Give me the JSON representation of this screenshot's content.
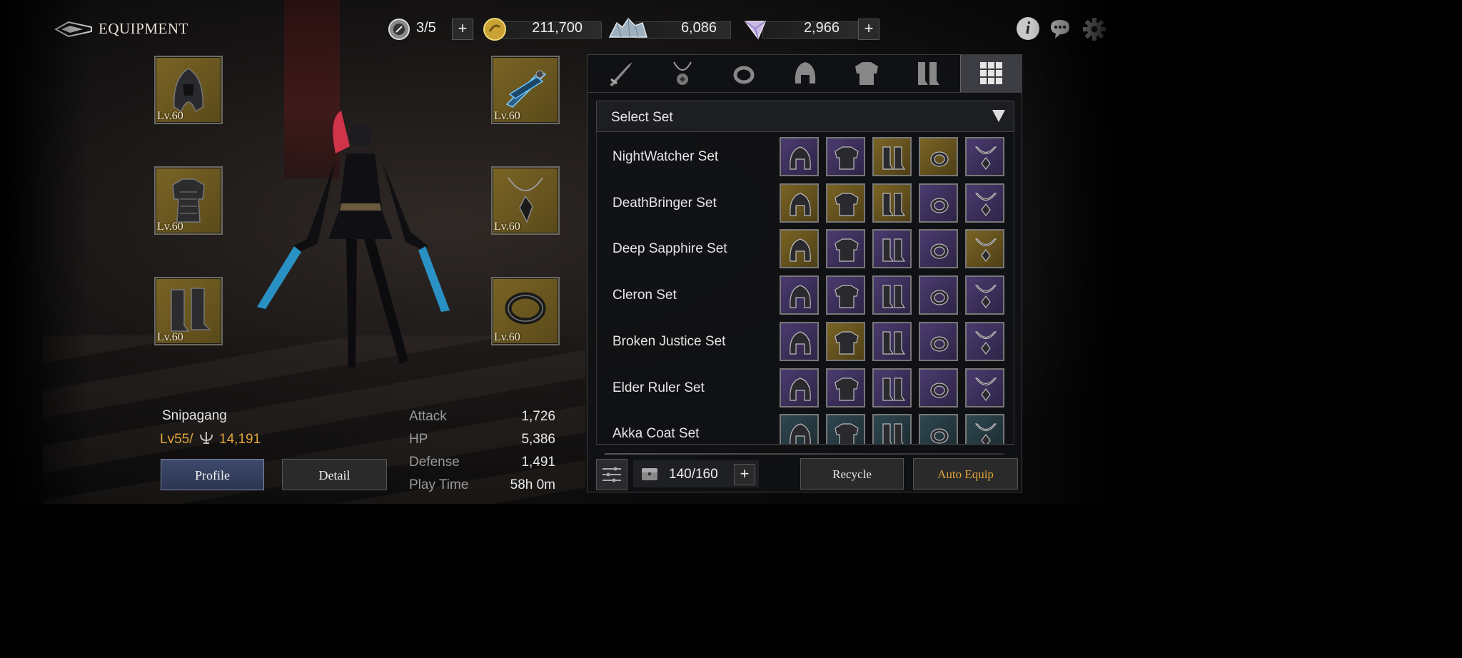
{
  "header": {
    "title": "EQUIPMENT",
    "stamina": "3/5",
    "gold": "211,700",
    "crystals": "6,086",
    "gems": "2,966"
  },
  "slots": [
    {
      "name": "helmet",
      "level": "Lv.60"
    },
    {
      "name": "dual-blades",
      "level": "Lv.60"
    },
    {
      "name": "armor",
      "level": "Lv.60"
    },
    {
      "name": "necklace",
      "level": "Lv.60"
    },
    {
      "name": "boots",
      "level": "Lv.60"
    },
    {
      "name": "ring",
      "level": "Lv.60"
    }
  ],
  "player": {
    "name": "Snipagang",
    "level": "Lv55/",
    "power": "14,191"
  },
  "stats": [
    {
      "label": "Attack",
      "value": "1,726"
    },
    {
      "label": "HP",
      "value": "5,386"
    },
    {
      "label": "Defense",
      "value": "1,491"
    },
    {
      "label": "Play Time",
      "value": "58h 0m"
    }
  ],
  "buttons": {
    "profile": "Profile",
    "detail": "Detail",
    "recycle": "Recycle",
    "auto_equip": "Auto Equip"
  },
  "panel": {
    "tabs": [
      "weapon",
      "necklace",
      "ring",
      "helmet",
      "armor",
      "boots",
      "all-sets"
    ],
    "select_set": "Select Set",
    "sets": [
      {
        "name": "NightWatcher Set",
        "items": [
          "p",
          "p",
          "g",
          "g",
          "p"
        ]
      },
      {
        "name": "DeathBringer Set",
        "items": [
          "g",
          "g",
          "g",
          "p",
          "p"
        ]
      },
      {
        "name": "Deep Sapphire Set",
        "items": [
          "g",
          "p",
          "p",
          "p",
          "g"
        ]
      },
      {
        "name": "Cleron Set",
        "items": [
          "p",
          "p",
          "p",
          "p",
          "p"
        ]
      },
      {
        "name": "Broken Justice Set",
        "items": [
          "p",
          "g",
          "p",
          "p",
          "p"
        ]
      },
      {
        "name": "Elder Ruler Set",
        "items": [
          "p",
          "p",
          "p",
          "p",
          "p"
        ]
      },
      {
        "name": "Akka Coat Set",
        "items": [
          "t",
          "t",
          "t",
          "t",
          "t"
        ]
      }
    ],
    "inventory": "140/160"
  },
  "colors": {
    "accent_gold": "#e0a53a",
    "slot_gold": "#7a6425",
    "rare_purple": "#4a3b6e",
    "common_teal": "#2f4750"
  }
}
